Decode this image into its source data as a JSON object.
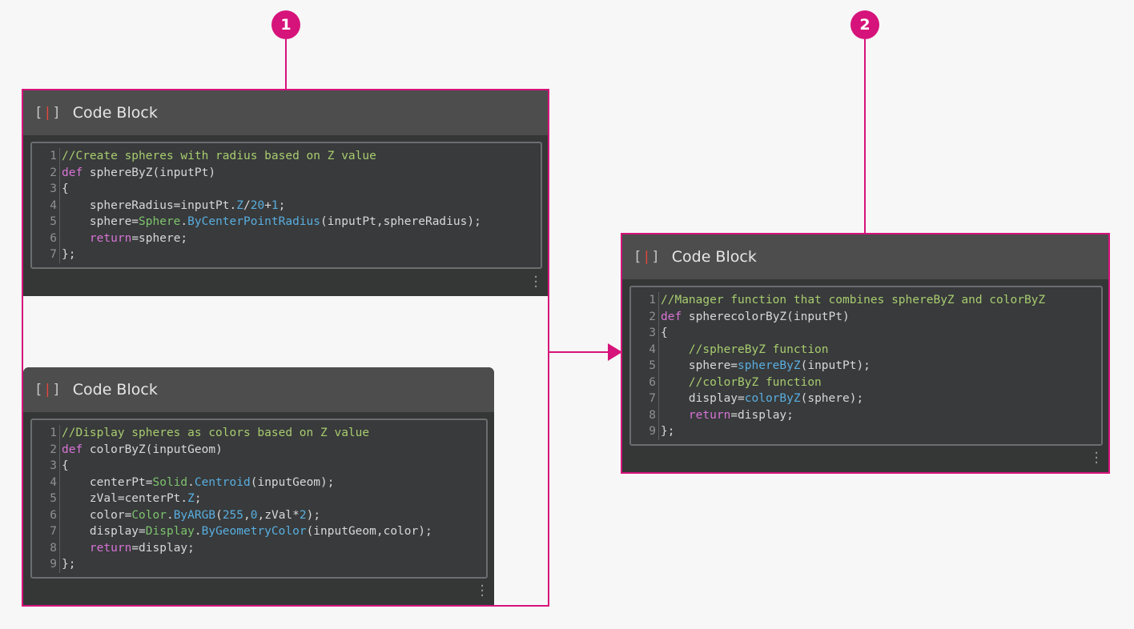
{
  "callouts": [
    "1",
    "2"
  ],
  "node_title": "Code Block",
  "nodes": [
    {
      "title": "Code Block",
      "lines": [
        {
          "n": "1",
          "tokens": [
            {
              "t": "//Create spheres with radius based on Z value",
              "c": "comment"
            }
          ]
        },
        {
          "n": "2",
          "tokens": [
            {
              "t": "def",
              "c": "keyword"
            },
            {
              "t": " sphereByZ(inputPt)",
              "c": "default"
            }
          ]
        },
        {
          "n": "3",
          "tokens": [
            {
              "t": "{",
              "c": "default"
            }
          ]
        },
        {
          "n": "4",
          "tokens": [
            {
              "t": "    sphereRadius=inputPt.",
              "c": "default"
            },
            {
              "t": "Z",
              "c": "method"
            },
            {
              "t": "/",
              "c": "default"
            },
            {
              "t": "20",
              "c": "number"
            },
            {
              "t": "+",
              "c": "default"
            },
            {
              "t": "1",
              "c": "number"
            },
            {
              "t": ";",
              "c": "default"
            }
          ]
        },
        {
          "n": "5",
          "tokens": [
            {
              "t": "    sphere=",
              "c": "default"
            },
            {
              "t": "Sphere",
              "c": "class"
            },
            {
              "t": ".",
              "c": "default"
            },
            {
              "t": "ByCenterPointRadius",
              "c": "method"
            },
            {
              "t": "(inputPt,sphereRadius);",
              "c": "default"
            }
          ]
        },
        {
          "n": "6",
          "tokens": [
            {
              "t": "    ",
              "c": "default"
            },
            {
              "t": "return",
              "c": "keyword"
            },
            {
              "t": "=sphere;",
              "c": "default"
            }
          ]
        },
        {
          "n": "7",
          "tokens": [
            {
              "t": "};",
              "c": "default"
            }
          ]
        }
      ]
    },
    {
      "title": "Code Block",
      "lines": [
        {
          "n": "1",
          "tokens": [
            {
              "t": "//Display spheres as colors based on Z value",
              "c": "comment"
            }
          ]
        },
        {
          "n": "2",
          "tokens": [
            {
              "t": "def",
              "c": "keyword"
            },
            {
              "t": " colorByZ(inputGeom)",
              "c": "default"
            }
          ]
        },
        {
          "n": "3",
          "tokens": [
            {
              "t": "{",
              "c": "default"
            }
          ]
        },
        {
          "n": "4",
          "tokens": [
            {
              "t": "    centerPt=",
              "c": "default"
            },
            {
              "t": "Solid",
              "c": "class"
            },
            {
              "t": ".",
              "c": "default"
            },
            {
              "t": "Centroid",
              "c": "method"
            },
            {
              "t": "(inputGeom);",
              "c": "default"
            }
          ]
        },
        {
          "n": "5",
          "tokens": [
            {
              "t": "    zVal=centerPt.",
              "c": "default"
            },
            {
              "t": "Z",
              "c": "method"
            },
            {
              "t": ";",
              "c": "default"
            }
          ]
        },
        {
          "n": "6",
          "tokens": [
            {
              "t": "    color=",
              "c": "default"
            },
            {
              "t": "Color",
              "c": "class"
            },
            {
              "t": ".",
              "c": "default"
            },
            {
              "t": "ByARGB",
              "c": "method"
            },
            {
              "t": "(",
              "c": "default"
            },
            {
              "t": "255",
              "c": "number"
            },
            {
              "t": ",",
              "c": "default"
            },
            {
              "t": "0",
              "c": "number"
            },
            {
              "t": ",zVal*",
              "c": "default"
            },
            {
              "t": "2",
              "c": "number"
            },
            {
              "t": ");",
              "c": "default"
            }
          ]
        },
        {
          "n": "7",
          "tokens": [
            {
              "t": "    display=",
              "c": "default"
            },
            {
              "t": "Display",
              "c": "class"
            },
            {
              "t": ".",
              "c": "default"
            },
            {
              "t": "ByGeometryColor",
              "c": "method"
            },
            {
              "t": "(inputGeom,color);",
              "c": "default"
            }
          ]
        },
        {
          "n": "8",
          "tokens": [
            {
              "t": "    ",
              "c": "default"
            },
            {
              "t": "return",
              "c": "keyword"
            },
            {
              "t": "=display;",
              "c": "default"
            }
          ]
        },
        {
          "n": "9",
          "tokens": [
            {
              "t": "};",
              "c": "default"
            }
          ]
        }
      ]
    },
    {
      "title": "Code Block",
      "lines": [
        {
          "n": "1",
          "tokens": [
            {
              "t": "//Manager function that combines sphereByZ and colorByZ",
              "c": "comment"
            }
          ]
        },
        {
          "n": "2",
          "tokens": [
            {
              "t": "def",
              "c": "keyword"
            },
            {
              "t": " spherecolorByZ(inputPt)",
              "c": "default"
            }
          ]
        },
        {
          "n": "3",
          "tokens": [
            {
              "t": "{",
              "c": "default"
            }
          ]
        },
        {
          "n": "4",
          "tokens": [
            {
              "t": "    ",
              "c": "default"
            },
            {
              "t": "//sphereByZ function",
              "c": "comment"
            }
          ]
        },
        {
          "n": "5",
          "tokens": [
            {
              "t": "    sphere=",
              "c": "default"
            },
            {
              "t": "sphereByZ",
              "c": "method"
            },
            {
              "t": "(inputPt);",
              "c": "default"
            }
          ]
        },
        {
          "n": "6",
          "tokens": [
            {
              "t": "    ",
              "c": "default"
            },
            {
              "t": "//colorByZ function",
              "c": "comment"
            }
          ]
        },
        {
          "n": "7",
          "tokens": [
            {
              "t": "    display=",
              "c": "default"
            },
            {
              "t": "colorByZ",
              "c": "method"
            },
            {
              "t": "(sphere);",
              "c": "default"
            }
          ]
        },
        {
          "n": "8",
          "tokens": [
            {
              "t": "    ",
              "c": "default"
            },
            {
              "t": "return",
              "c": "keyword"
            },
            {
              "t": "=display;",
              "c": "default"
            }
          ]
        },
        {
          "n": "9",
          "tokens": [
            {
              "t": "};",
              "c": "default"
            }
          ]
        }
      ]
    }
  ],
  "colors": {
    "accent": "#d6137a",
    "node_body": "#353737",
    "node_header": "#4d4d4d",
    "comment": "#a8cc6f",
    "keyword": "#d873d6",
    "class": "#7ec36e",
    "method": "#59aee0"
  },
  "icons": {
    "node_icon": "code-block-bracket-icon",
    "resize_handle": "vertical-dots-icon",
    "connector_arrow": "arrow-right-icon"
  }
}
